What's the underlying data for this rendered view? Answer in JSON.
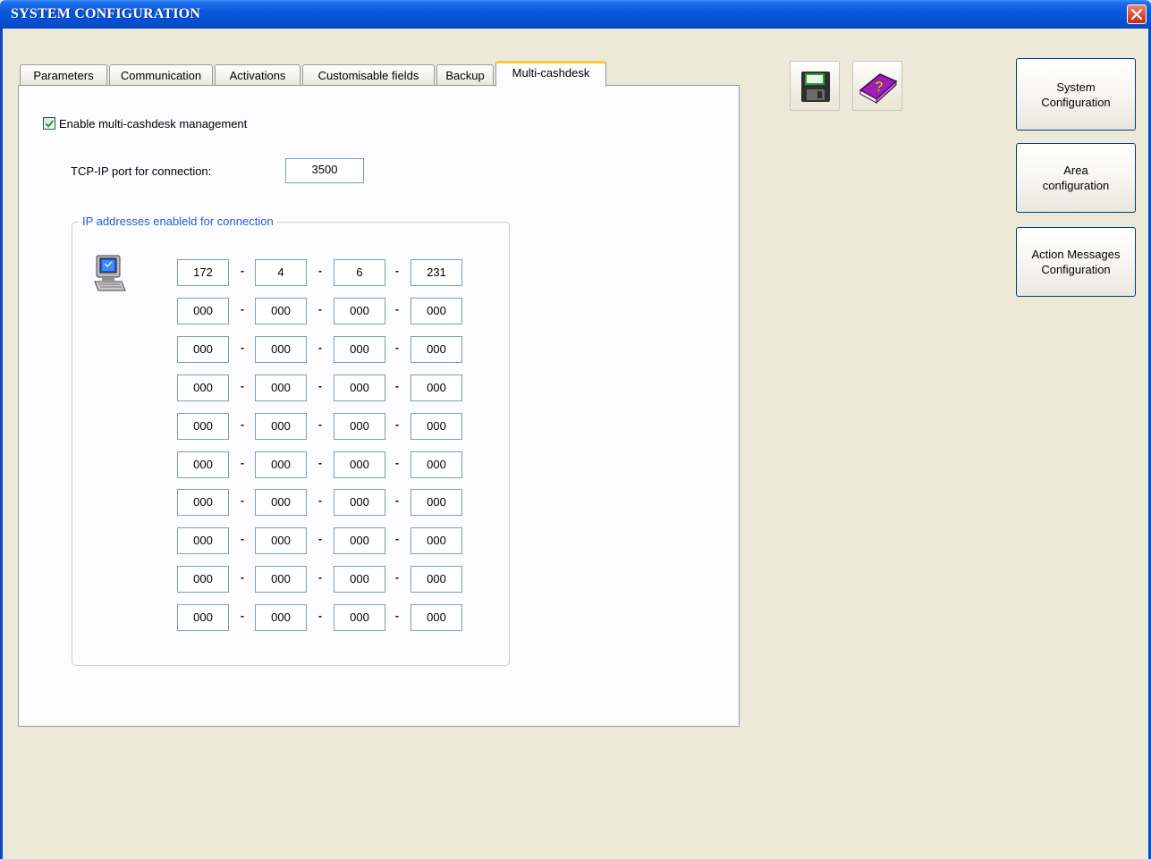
{
  "window": {
    "title": "SYSTEM CONFIGURATION"
  },
  "tabs": [
    {
      "label": "Parameters"
    },
    {
      "label": "Communication"
    },
    {
      "label": "Activations"
    },
    {
      "label": "Customisable fields"
    },
    {
      "label": "Backup"
    },
    {
      "label": "Multi-cashdesk",
      "active": true
    }
  ],
  "multicash": {
    "enable_label": "Enable multi-cashdesk management",
    "enable_checked": true,
    "port_label": "TCP-IP port for connection:",
    "port_value": "3500",
    "group_title": "IP addresses enableld for connection",
    "separator": "-",
    "ip_rows": [
      [
        "172",
        "4",
        "6",
        "231"
      ],
      [
        "000",
        "000",
        "000",
        "000"
      ],
      [
        "000",
        "000",
        "000",
        "000"
      ],
      [
        "000",
        "000",
        "000",
        "000"
      ],
      [
        "000",
        "000",
        "000",
        "000"
      ],
      [
        "000",
        "000",
        "000",
        "000"
      ],
      [
        "000",
        "000",
        "000",
        "000"
      ],
      [
        "000",
        "000",
        "000",
        "000"
      ],
      [
        "000",
        "000",
        "000",
        "000"
      ],
      [
        "000",
        "000",
        "000",
        "000"
      ]
    ]
  },
  "toolbar": {
    "save_icon": "floppy-disk-icon",
    "help_icon": "help-book-icon"
  },
  "side_buttons": {
    "system": [
      "System",
      "Configuration"
    ],
    "area": [
      "Area",
      "configuration"
    ],
    "action": [
      "Action Messages",
      "Configuration"
    ]
  }
}
